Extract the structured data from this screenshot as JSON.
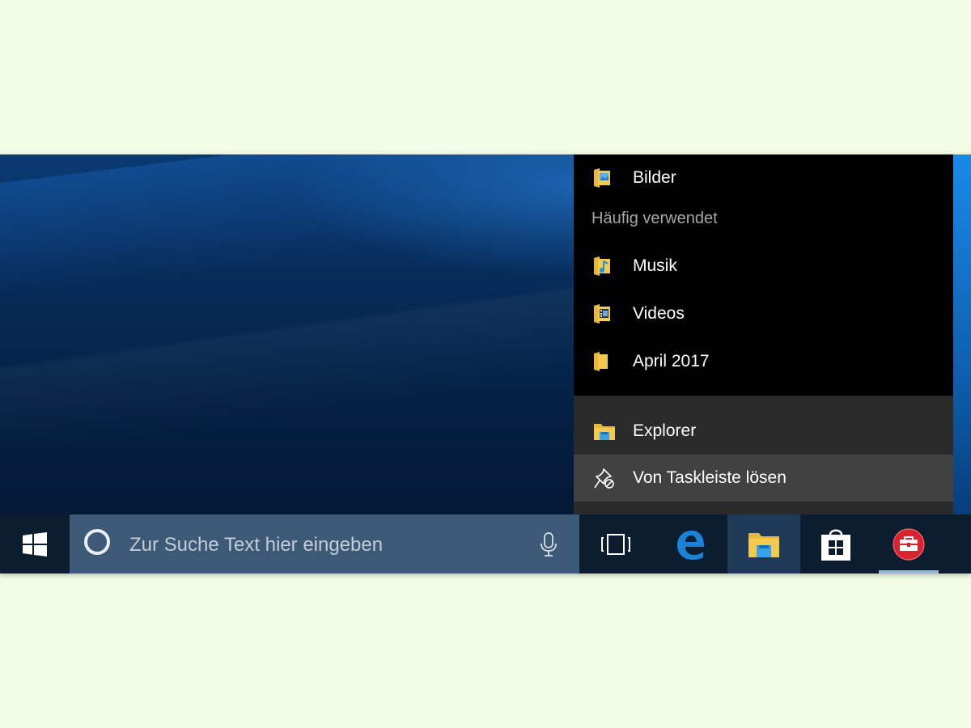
{
  "jumplist": {
    "pinned_items": [
      {
        "label": "Bilder",
        "icon": "pictures-folder-icon"
      }
    ],
    "frequent_header": "Häufig verwendet",
    "frequent_items": [
      {
        "label": "Musik",
        "icon": "music-folder-icon"
      },
      {
        "label": "Videos",
        "icon": "videos-folder-icon"
      },
      {
        "label": "April 2017",
        "icon": "folder-icon"
      }
    ],
    "actions": [
      {
        "label": "Explorer",
        "icon": "file-explorer-icon"
      },
      {
        "label": "Von Taskleiste lösen",
        "icon": "unpin-icon"
      }
    ]
  },
  "taskbar": {
    "search_placeholder": "Zur Suche Text hier eingeben",
    "apps": [
      {
        "name": "task-view",
        "icon": "task-view-icon"
      },
      {
        "name": "edge",
        "icon": "edge-icon"
      },
      {
        "name": "file-explorer",
        "icon": "file-explorer-icon"
      },
      {
        "name": "store",
        "icon": "store-icon"
      },
      {
        "name": "toolbox",
        "icon": "toolbox-icon"
      }
    ]
  },
  "colors": {
    "taskbar": "#0d1d30",
    "search": "#3c5a76",
    "jumplist": "#000000",
    "jumplist_actions": "#2b2b2b",
    "hover": "#414141",
    "folder": "#f3c94f"
  }
}
